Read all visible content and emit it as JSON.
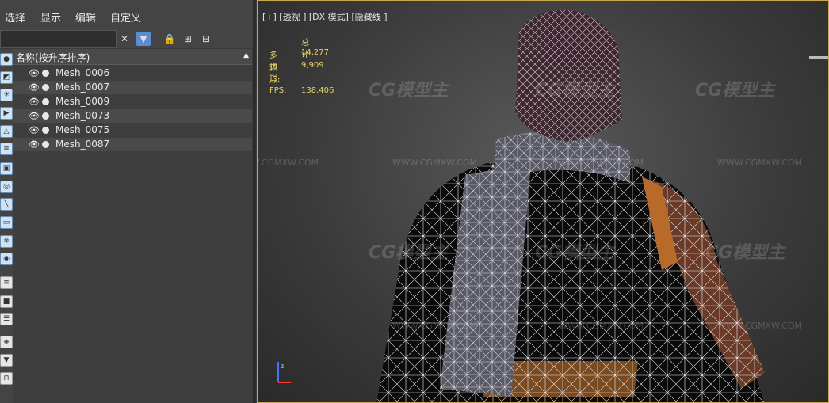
{
  "menu": {
    "items": [
      "选择",
      "显示",
      "编辑",
      "自定义"
    ]
  },
  "explorer": {
    "column_header": "名称(按升序排序)",
    "rows": [
      {
        "label": "Mesh_0006"
      },
      {
        "label": "Mesh_0007"
      },
      {
        "label": "Mesh_0009"
      },
      {
        "label": "Mesh_0073"
      },
      {
        "label": "Mesh_0075"
      },
      {
        "label": "Mesh_0087"
      }
    ]
  },
  "viewport": {
    "label": "[+] [透视 ] [DX 模式] [隐藏线 ]",
    "stats": {
      "total_label": "总计",
      "polys_label": "多边形:",
      "polys_value": "14,277",
      "verts_label": "顶点:",
      "verts_value": "9,909",
      "fps_label": "FPS:",
      "fps_value": "138.406"
    },
    "watermark_text": "CG模型主",
    "watermark_url": "WWW.CGMXW.COM"
  },
  "colors": {
    "accent": "#5a8ccf",
    "viewport_border": "#c8a84a",
    "stats_text": "#e6d36a"
  }
}
